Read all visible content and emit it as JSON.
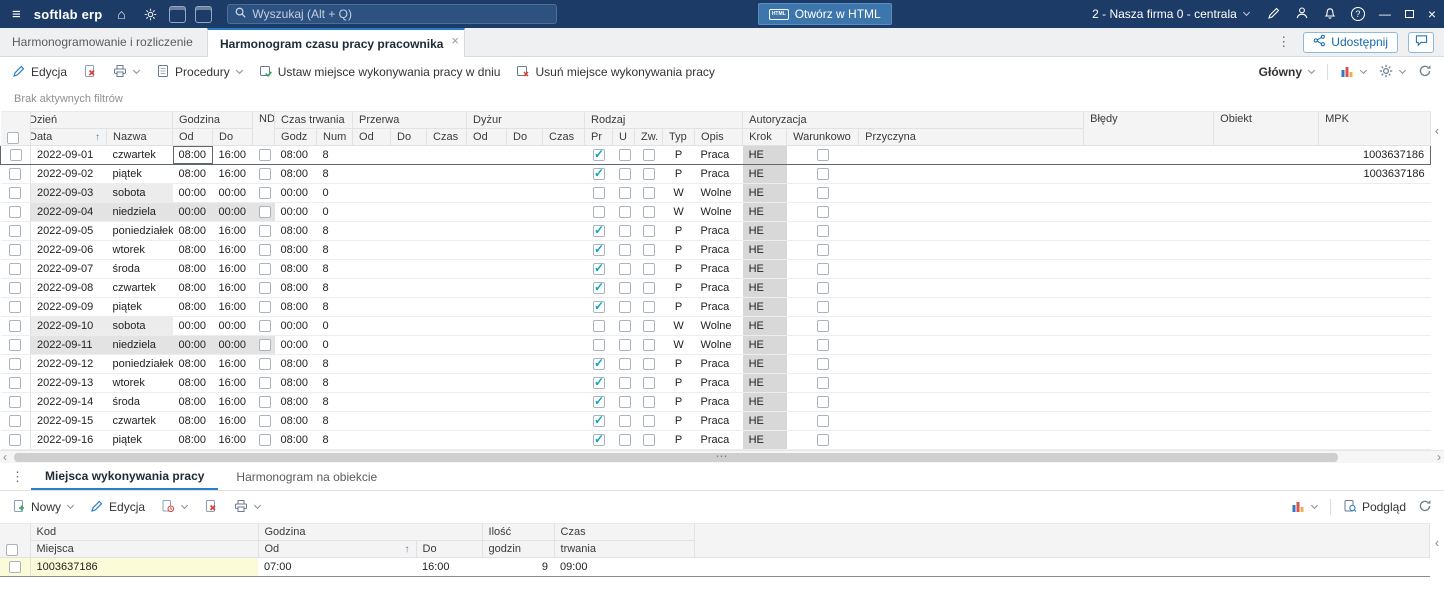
{
  "colors": {
    "topbar_bg": "#1c3c67",
    "accent": "#1a73b5",
    "check": "#0aa5c2",
    "header_bg": "#f4f4f4",
    "krok_bg": "#d8d8d8",
    "saturday_bg": "#ececec",
    "sunday_bg": "#e3e3e3",
    "selected_row_yellow": "#fbfbd7",
    "delete_red": "#d9403a",
    "ok_green": "#3aa655"
  },
  "icons": {
    "menu": "≡",
    "home": "⌂",
    "close": "×",
    "minimize": "—",
    "overflow_dots": "⋮",
    "splitter_dots": "⋯",
    "collapse": "‹",
    "scroll_left": "‹",
    "scroll_right": "›"
  },
  "topbar": {
    "app_name": "softlab erp",
    "search_placeholder": "Wyszukaj (Alt + Q)",
    "open_html": "Otwórz w HTML",
    "html_badge": "HTML",
    "company": "2 - Nasza firma 0 - centrala"
  },
  "tabbar": {
    "tabs": [
      {
        "label": "Harmonogramowanie i rozliczenie czasu"
      },
      {
        "label": "Harmonogram czasu pracy pracownika"
      }
    ],
    "share": "Udostępnij"
  },
  "toolbar": {
    "edit": "Edycja",
    "procedures": "Procedury",
    "set_place": "Ustaw miejsce wykonywania pracy w dniu",
    "remove_place": "Usuń miejsce wykonywania pracy",
    "view": "Główny"
  },
  "filters_info": "Brak aktywnych filtrów",
  "main_grid": {
    "groups": {
      "dzien": "Dzień",
      "godzina": "Godzina",
      "nd": "ND",
      "czas_trwania": "Czas trwania",
      "przerwa": "Przerwa",
      "dyzur": "Dyżur",
      "rodzaj": "Rodzaj",
      "autoryzacja": "Autoryzacja",
      "bledy": "Błędy",
      "obiekt": "Obiekt",
      "mpk": "MPK"
    },
    "columns": {
      "data": "Data",
      "nazwa": "Nazwa",
      "od": "Od",
      "do": "Do",
      "godz": "Godz",
      "num": "Num",
      "czas": "Czas",
      "pr": "Pr",
      "u": "U",
      "zw": "Zw.",
      "typ": "Typ",
      "opis": "Opis",
      "krok": "Krok",
      "warunkowo": "Warunkowo",
      "przyczyna": "Przyczyna"
    },
    "sort_indicator": "↑",
    "rows": [
      {
        "data": "2022-09-01",
        "nazwa": "czwartek",
        "od": "08:00",
        "do": "16:00",
        "nd": false,
        "godz": "08:00",
        "num": "8",
        "pr": true,
        "u": false,
        "zw": false,
        "typ": "P",
        "opis": "Praca",
        "krok": "HE",
        "warunkowo": false,
        "mpk": "1003637186",
        "day": "work",
        "focused": true
      },
      {
        "data": "2022-09-02",
        "nazwa": "piątek",
        "od": "08:00",
        "do": "16:00",
        "nd": false,
        "godz": "08:00",
        "num": "8",
        "pr": true,
        "u": false,
        "zw": false,
        "typ": "P",
        "opis": "Praca",
        "krok": "HE",
        "warunkowo": false,
        "mpk": "1003637186",
        "day": "work"
      },
      {
        "data": "2022-09-03",
        "nazwa": "sobota",
        "od": "00:00",
        "do": "00:00",
        "nd": false,
        "godz": "00:00",
        "num": "0",
        "pr": false,
        "u": false,
        "zw": false,
        "typ": "W",
        "opis": "Wolne",
        "krok": "HE",
        "warunkowo": false,
        "mpk": "",
        "day": "sat"
      },
      {
        "data": "2022-09-04",
        "nazwa": "niedziela",
        "od": "00:00",
        "do": "00:00",
        "nd": false,
        "godz": "00:00",
        "num": "0",
        "pr": false,
        "u": false,
        "zw": false,
        "typ": "W",
        "opis": "Wolne",
        "krok": "HE",
        "warunkowo": false,
        "mpk": "",
        "day": "sun"
      },
      {
        "data": "2022-09-05",
        "nazwa": "poniedziałek",
        "od": "08:00",
        "do": "16:00",
        "nd": false,
        "godz": "08:00",
        "num": "8",
        "pr": true,
        "u": false,
        "zw": false,
        "typ": "P",
        "opis": "Praca",
        "krok": "HE",
        "warunkowo": false,
        "mpk": "",
        "day": "work"
      },
      {
        "data": "2022-09-06",
        "nazwa": "wtorek",
        "od": "08:00",
        "do": "16:00",
        "nd": false,
        "godz": "08:00",
        "num": "8",
        "pr": true,
        "u": false,
        "zw": false,
        "typ": "P",
        "opis": "Praca",
        "krok": "HE",
        "warunkowo": false,
        "mpk": "",
        "day": "work"
      },
      {
        "data": "2022-09-07",
        "nazwa": "środa",
        "od": "08:00",
        "do": "16:00",
        "nd": false,
        "godz": "08:00",
        "num": "8",
        "pr": true,
        "u": false,
        "zw": false,
        "typ": "P",
        "opis": "Praca",
        "krok": "HE",
        "warunkowo": false,
        "mpk": "",
        "day": "work"
      },
      {
        "data": "2022-09-08",
        "nazwa": "czwartek",
        "od": "08:00",
        "do": "16:00",
        "nd": false,
        "godz": "08:00",
        "num": "8",
        "pr": true,
        "u": false,
        "zw": false,
        "typ": "P",
        "opis": "Praca",
        "krok": "HE",
        "warunkowo": false,
        "mpk": "",
        "day": "work"
      },
      {
        "data": "2022-09-09",
        "nazwa": "piątek",
        "od": "08:00",
        "do": "16:00",
        "nd": false,
        "godz": "08:00",
        "num": "8",
        "pr": true,
        "u": false,
        "zw": false,
        "typ": "P",
        "opis": "Praca",
        "krok": "HE",
        "warunkowo": false,
        "mpk": "",
        "day": "work"
      },
      {
        "data": "2022-09-10",
        "nazwa": "sobota",
        "od": "00:00",
        "do": "00:00",
        "nd": false,
        "godz": "00:00",
        "num": "0",
        "pr": false,
        "u": false,
        "zw": false,
        "typ": "W",
        "opis": "Wolne",
        "krok": "HE",
        "warunkowo": false,
        "mpk": "",
        "day": "sat"
      },
      {
        "data": "2022-09-11",
        "nazwa": "niedziela",
        "od": "00:00",
        "do": "00:00",
        "nd": false,
        "godz": "00:00",
        "num": "0",
        "pr": false,
        "u": false,
        "zw": false,
        "typ": "W",
        "opis": "Wolne",
        "krok": "HE",
        "warunkowo": false,
        "mpk": "",
        "day": "sun"
      },
      {
        "data": "2022-09-12",
        "nazwa": "poniedziałek",
        "od": "08:00",
        "do": "16:00",
        "nd": false,
        "godz": "08:00",
        "num": "8",
        "pr": true,
        "u": false,
        "zw": false,
        "typ": "P",
        "opis": "Praca",
        "krok": "HE",
        "warunkowo": false,
        "mpk": "",
        "day": "work"
      },
      {
        "data": "2022-09-13",
        "nazwa": "wtorek",
        "od": "08:00",
        "do": "16:00",
        "nd": false,
        "godz": "08:00",
        "num": "8",
        "pr": true,
        "u": false,
        "zw": false,
        "typ": "P",
        "opis": "Praca",
        "krok": "HE",
        "warunkowo": false,
        "mpk": "",
        "day": "work"
      },
      {
        "data": "2022-09-14",
        "nazwa": "środa",
        "od": "08:00",
        "do": "16:00",
        "nd": false,
        "godz": "08:00",
        "num": "8",
        "pr": true,
        "u": false,
        "zw": false,
        "typ": "P",
        "opis": "Praca",
        "krok": "HE",
        "warunkowo": false,
        "mpk": "",
        "day": "work"
      },
      {
        "data": "2022-09-15",
        "nazwa": "czwartek",
        "od": "08:00",
        "do": "16:00",
        "nd": false,
        "godz": "08:00",
        "num": "8",
        "pr": true,
        "u": false,
        "zw": false,
        "typ": "P",
        "opis": "Praca",
        "krok": "HE",
        "warunkowo": false,
        "mpk": "",
        "day": "work"
      },
      {
        "data": "2022-09-16",
        "nazwa": "piątek",
        "od": "08:00",
        "do": "16:00",
        "nd": false,
        "godz": "08:00",
        "num": "8",
        "pr": true,
        "u": false,
        "zw": false,
        "typ": "P",
        "opis": "Praca",
        "krok": "HE",
        "warunkowo": false,
        "mpk": "",
        "day": "work"
      }
    ]
  },
  "bottom_panel": {
    "tabs": [
      {
        "label": "Miejsca wykonywania pracy",
        "active": true
      },
      {
        "label": "Harmonogram na obiekcie",
        "active": false
      }
    ],
    "toolbar": {
      "new": "Nowy",
      "edit": "Edycja",
      "preview": "Podgląd"
    },
    "grid": {
      "groups": {
        "kod": "Kod",
        "godzina": "Godzina",
        "ilosc": "Ilość",
        "czas": "Czas"
      },
      "columns": {
        "miejsca": "Miejsca",
        "od": "Od",
        "do": "Do",
        "godzin": "godzin",
        "trwania": "trwania"
      },
      "sort_indicator": "↑",
      "rows": [
        {
          "kod": "1003637186",
          "od": "07:00",
          "do": "16:00",
          "ilosc": "9",
          "czas": "09:00"
        }
      ]
    }
  }
}
